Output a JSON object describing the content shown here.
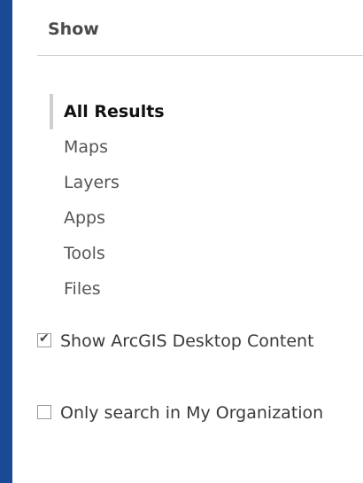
{
  "show": {
    "title": "Show",
    "filters": [
      {
        "label": "All Results",
        "active": true
      },
      {
        "label": "Maps",
        "active": false
      },
      {
        "label": "Layers",
        "active": false
      },
      {
        "label": "Apps",
        "active": false
      },
      {
        "label": "Tools",
        "active": false
      },
      {
        "label": "Files",
        "active": false
      }
    ]
  },
  "options": {
    "desktop_content": {
      "label": "Show ArcGIS Desktop Content",
      "checked": true
    },
    "my_org": {
      "label": "Only search in My Organization",
      "checked": false
    }
  },
  "colors": {
    "frame_background": "#1a4a96",
    "panel_background": "#ffffff",
    "active_marker": "#cfcfcf"
  },
  "icons": {
    "checked": "check-icon"
  }
}
